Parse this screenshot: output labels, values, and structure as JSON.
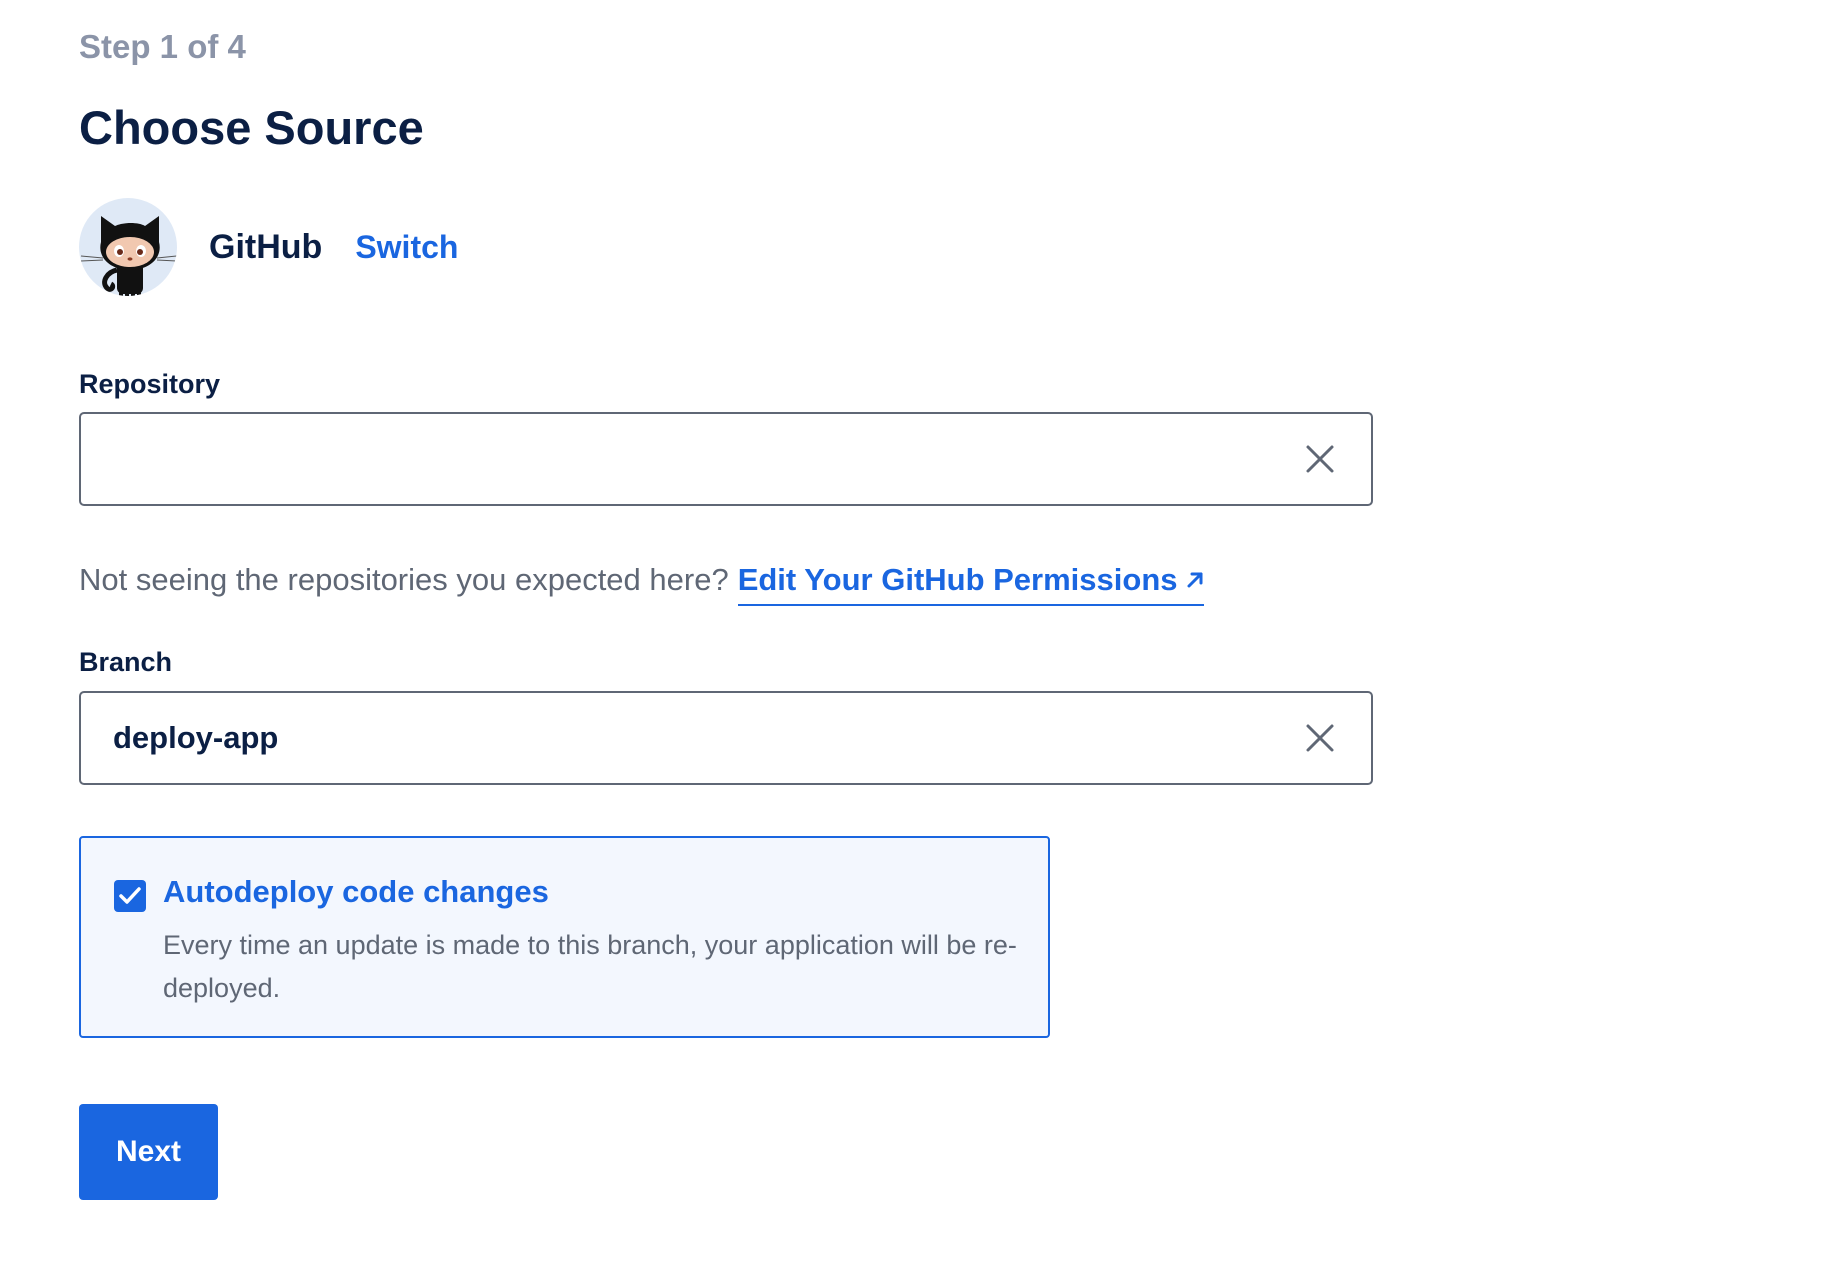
{
  "header": {
    "step": "Step 1 of 4",
    "title": "Choose Source"
  },
  "provider": {
    "name": "GitHub",
    "switch_label": "Switch",
    "avatar_icon": "github-octocat-icon"
  },
  "repository": {
    "label": "Repository",
    "value": "",
    "clear_icon": "close-icon"
  },
  "help": {
    "text": "Not seeing the repositories you expected here?",
    "link_label": "Edit Your GitHub Permissions",
    "link_icon": "external-link-arrow-icon"
  },
  "branch": {
    "label": "Branch",
    "value": "deploy-app",
    "clear_icon": "close-icon"
  },
  "autodeploy": {
    "checked": true,
    "title": "Autodeploy code changes",
    "description": "Every time an update is made to this branch, your application will be re-deployed."
  },
  "actions": {
    "next_label": "Next"
  },
  "colors": {
    "accent": "#1a66e0",
    "heading": "#0b1f44",
    "muted": "#8b94a8",
    "body": "#5f6775",
    "autodeploy_bg": "#f3f7fe"
  }
}
